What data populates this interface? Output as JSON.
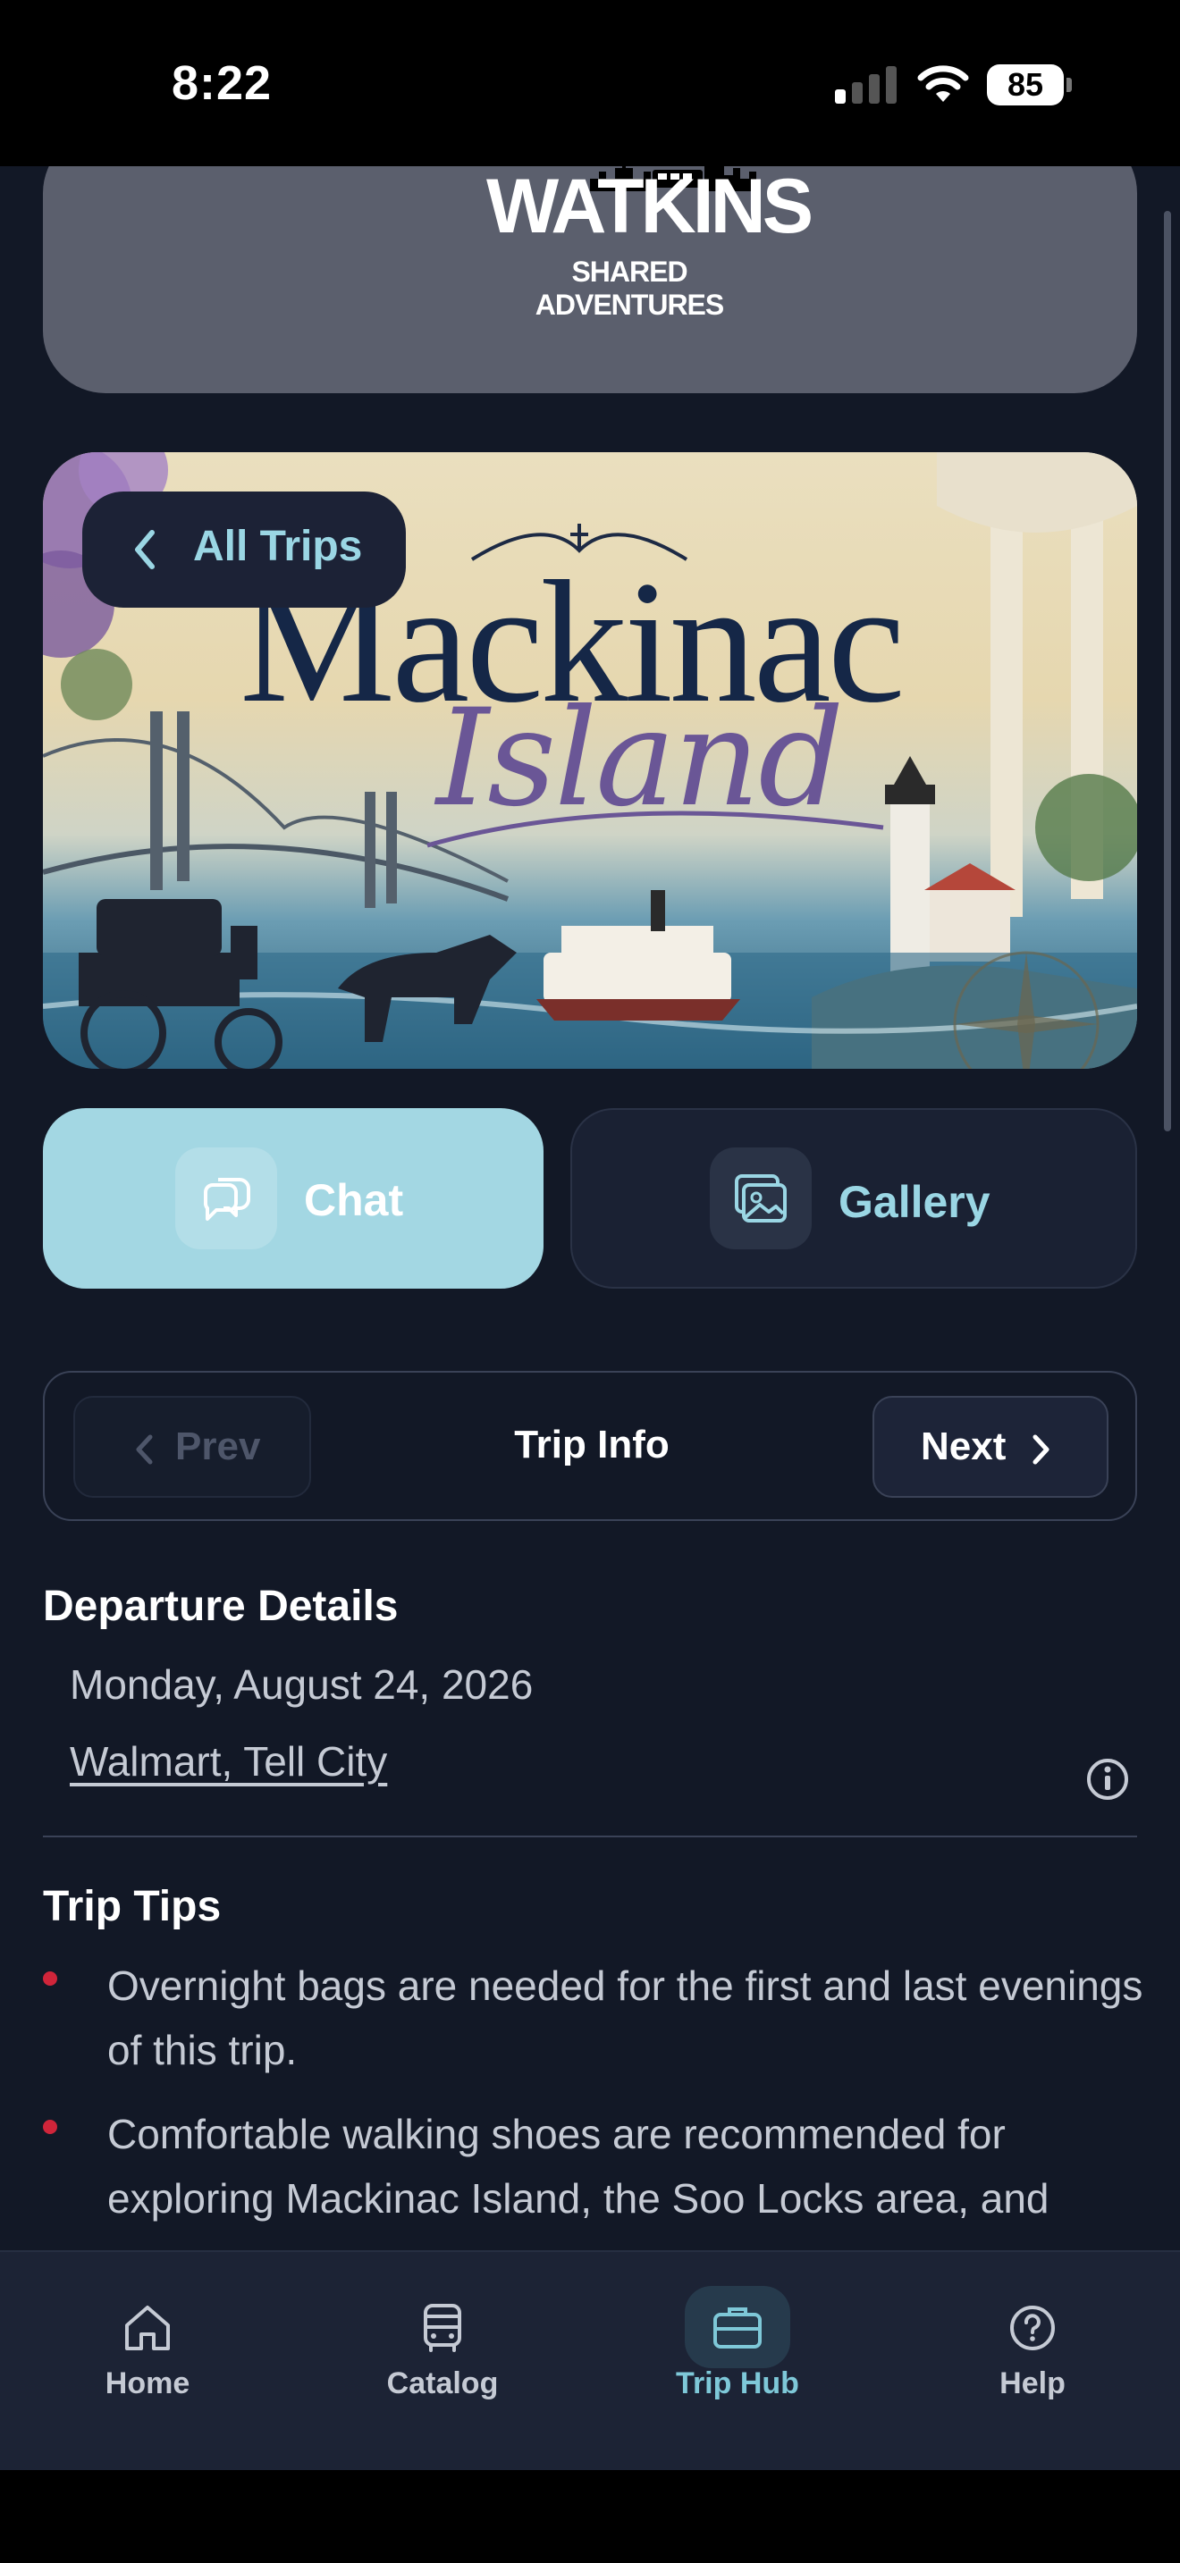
{
  "status": {
    "time": "8:22",
    "battery": "85"
  },
  "logo": {
    "title": "WATKINS",
    "subtitle": "SHARED ADVENTURES"
  },
  "hero": {
    "title": "Mackinac",
    "subtitle": "Island",
    "back_label": "All Trips"
  },
  "actions": {
    "chat_label": "Chat",
    "gallery_label": "Gallery"
  },
  "pager": {
    "prev_label": "Prev",
    "title": "Trip Info",
    "next_label": "Next"
  },
  "departure": {
    "heading": "Departure Details",
    "date": "Monday, August 24, 2026",
    "location": "Walmart, Tell City"
  },
  "tips": {
    "heading": "Trip Tips",
    "items": [
      "Overnight bags are needed for the first and last evenings of this trip.",
      "Comfortable walking shoes are recommended for exploring Mackinac Island, the Soo Locks area, and"
    ]
  },
  "tabs": [
    {
      "label": "Home",
      "icon": "home-icon"
    },
    {
      "label": "Catalog",
      "icon": "bus-icon"
    },
    {
      "label": "Trip Hub",
      "icon": "briefcase-icon"
    },
    {
      "label": "Help",
      "icon": "help-icon"
    }
  ],
  "colors": {
    "background": "#121826",
    "accent": "#9ad6e4",
    "chat_button": "#a3d7e3",
    "bullet": "#d0253a"
  }
}
